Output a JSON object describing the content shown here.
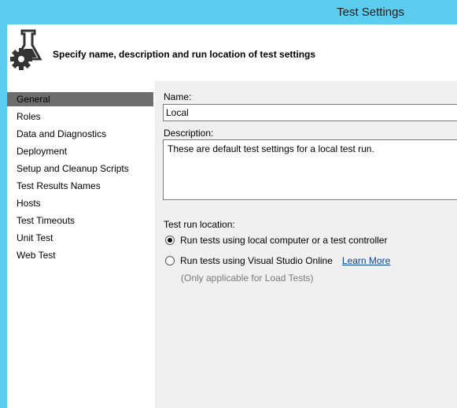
{
  "window": {
    "title": "Test Settings"
  },
  "header": {
    "text": "Specify name, description and run location of test settings",
    "icon": "flask-gear-icon"
  },
  "nav": {
    "items": [
      {
        "label": "General",
        "selected": true
      },
      {
        "label": "Roles"
      },
      {
        "label": "Data and Diagnostics"
      },
      {
        "label": "Deployment"
      },
      {
        "label": "Setup and Cleanup Scripts"
      },
      {
        "label": "Test Results Names"
      },
      {
        "label": "Hosts"
      },
      {
        "label": "Test Timeouts"
      },
      {
        "label": "Unit Test"
      },
      {
        "label": "Web Test"
      }
    ]
  },
  "form": {
    "name_label": "Name:",
    "name_value": "Local",
    "description_label": "Description:",
    "description_value": "These are default test settings for a local test run.",
    "run_location_label": "Test run location:",
    "option_local": "Run tests using local computer or a test controller",
    "option_online": "Run tests using Visual Studio Online",
    "learn_more": "Learn More",
    "load_note": "(Only applicable for Load Tests)"
  },
  "colors": {
    "accent": "#5ccdef",
    "selected": "#6d6d6d",
    "link": "#0645ad"
  }
}
